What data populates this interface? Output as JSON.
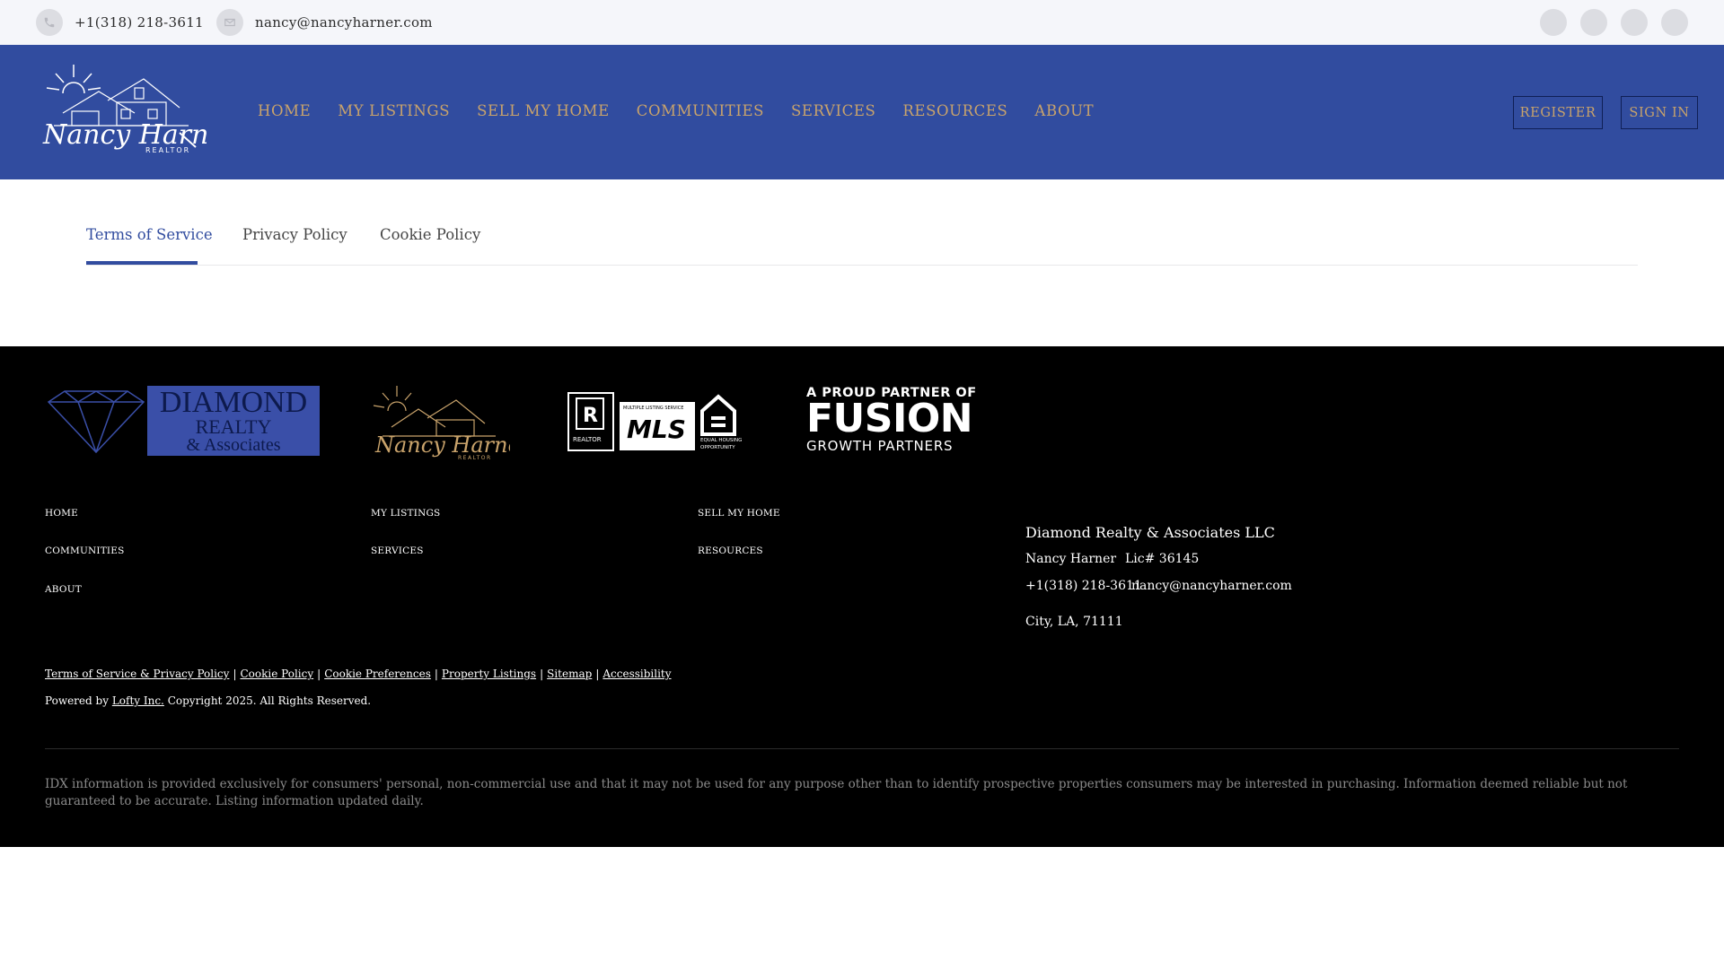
{
  "topbar": {
    "phone": "+1(318) 218-3611",
    "email": "nancy@nancyharner.com",
    "social_icons": [
      "facebook-icon",
      "instagram-icon",
      "linkedin-icon",
      "youtube-icon"
    ]
  },
  "header": {
    "logo": {
      "name": "Nancy Harner",
      "subtitle": "REALTOR"
    },
    "nav": [
      "HOME",
      "MY LISTINGS",
      "SELL MY HOME",
      "COMMUNITIES",
      "SERVICES",
      "RESOURCES",
      "ABOUT"
    ],
    "register_label": "REGISTER",
    "signin_label": "SIGN IN"
  },
  "tabs": [
    {
      "label": "Terms of Service",
      "active": true
    },
    {
      "label": "Privacy Policy",
      "active": false
    },
    {
      "label": "Cookie Policy",
      "active": false
    }
  ],
  "footer": {
    "logos": {
      "diamond": {
        "line1": "DIAMOND",
        "line2": "REALTY",
        "line3": "& Associates"
      },
      "nancy": {
        "name": "Nancy Harner",
        "subtitle": "REALTOR"
      },
      "mls": {
        "realtor": "REALTOR",
        "mls_small": "MULTIPLE LISTING SERVICE",
        "mls": "MLS",
        "equal1": "EQUAL HOUSING",
        "equal2": "OPPORTUNITY"
      },
      "fusion": {
        "line1": "A PROUD PARTNER OF",
        "line2": "FUSION",
        "line3": "GROWTH PARTNERS"
      }
    },
    "links": [
      "HOME",
      "MY LISTINGS",
      "SELL MY HOME",
      "COMMUNITIES",
      "SERVICES",
      "RESOURCES",
      "ABOUT"
    ],
    "company": "Diamond Realty & Associates LLC",
    "agent": "Nancy Harner",
    "license": "Lic# 36145",
    "phone": "+1(318) 218-3611",
    "email": "nancy@nancyharner.com",
    "address": "City, LA, 71111",
    "legal_links": [
      "Terms of Service & Privacy Policy",
      "Cookie Policy",
      "Cookie Preferences",
      "Property Listings",
      "Sitemap",
      "Accessibility"
    ],
    "powered_prefix": "Powered by",
    "powered_link": "Lofty Inc.",
    "copyright": "Copyright 2025. All Rights Reserved.",
    "disclaimer": "IDX information is provided exclusively for consumers' personal, non-commercial use and that it may not be used for any purpose other than to identify prospective properties consumers may be interested in purchasing. Information deemed reliable but not guaranteed to be accurate. Listing information updated daily."
  },
  "colors": {
    "header_bg": "#314c9f",
    "nav_gold": "#c9a36b",
    "footer_bg": "#000000",
    "tab_active": "#314c9f",
    "topbar_bg": "#f5f6fa"
  }
}
